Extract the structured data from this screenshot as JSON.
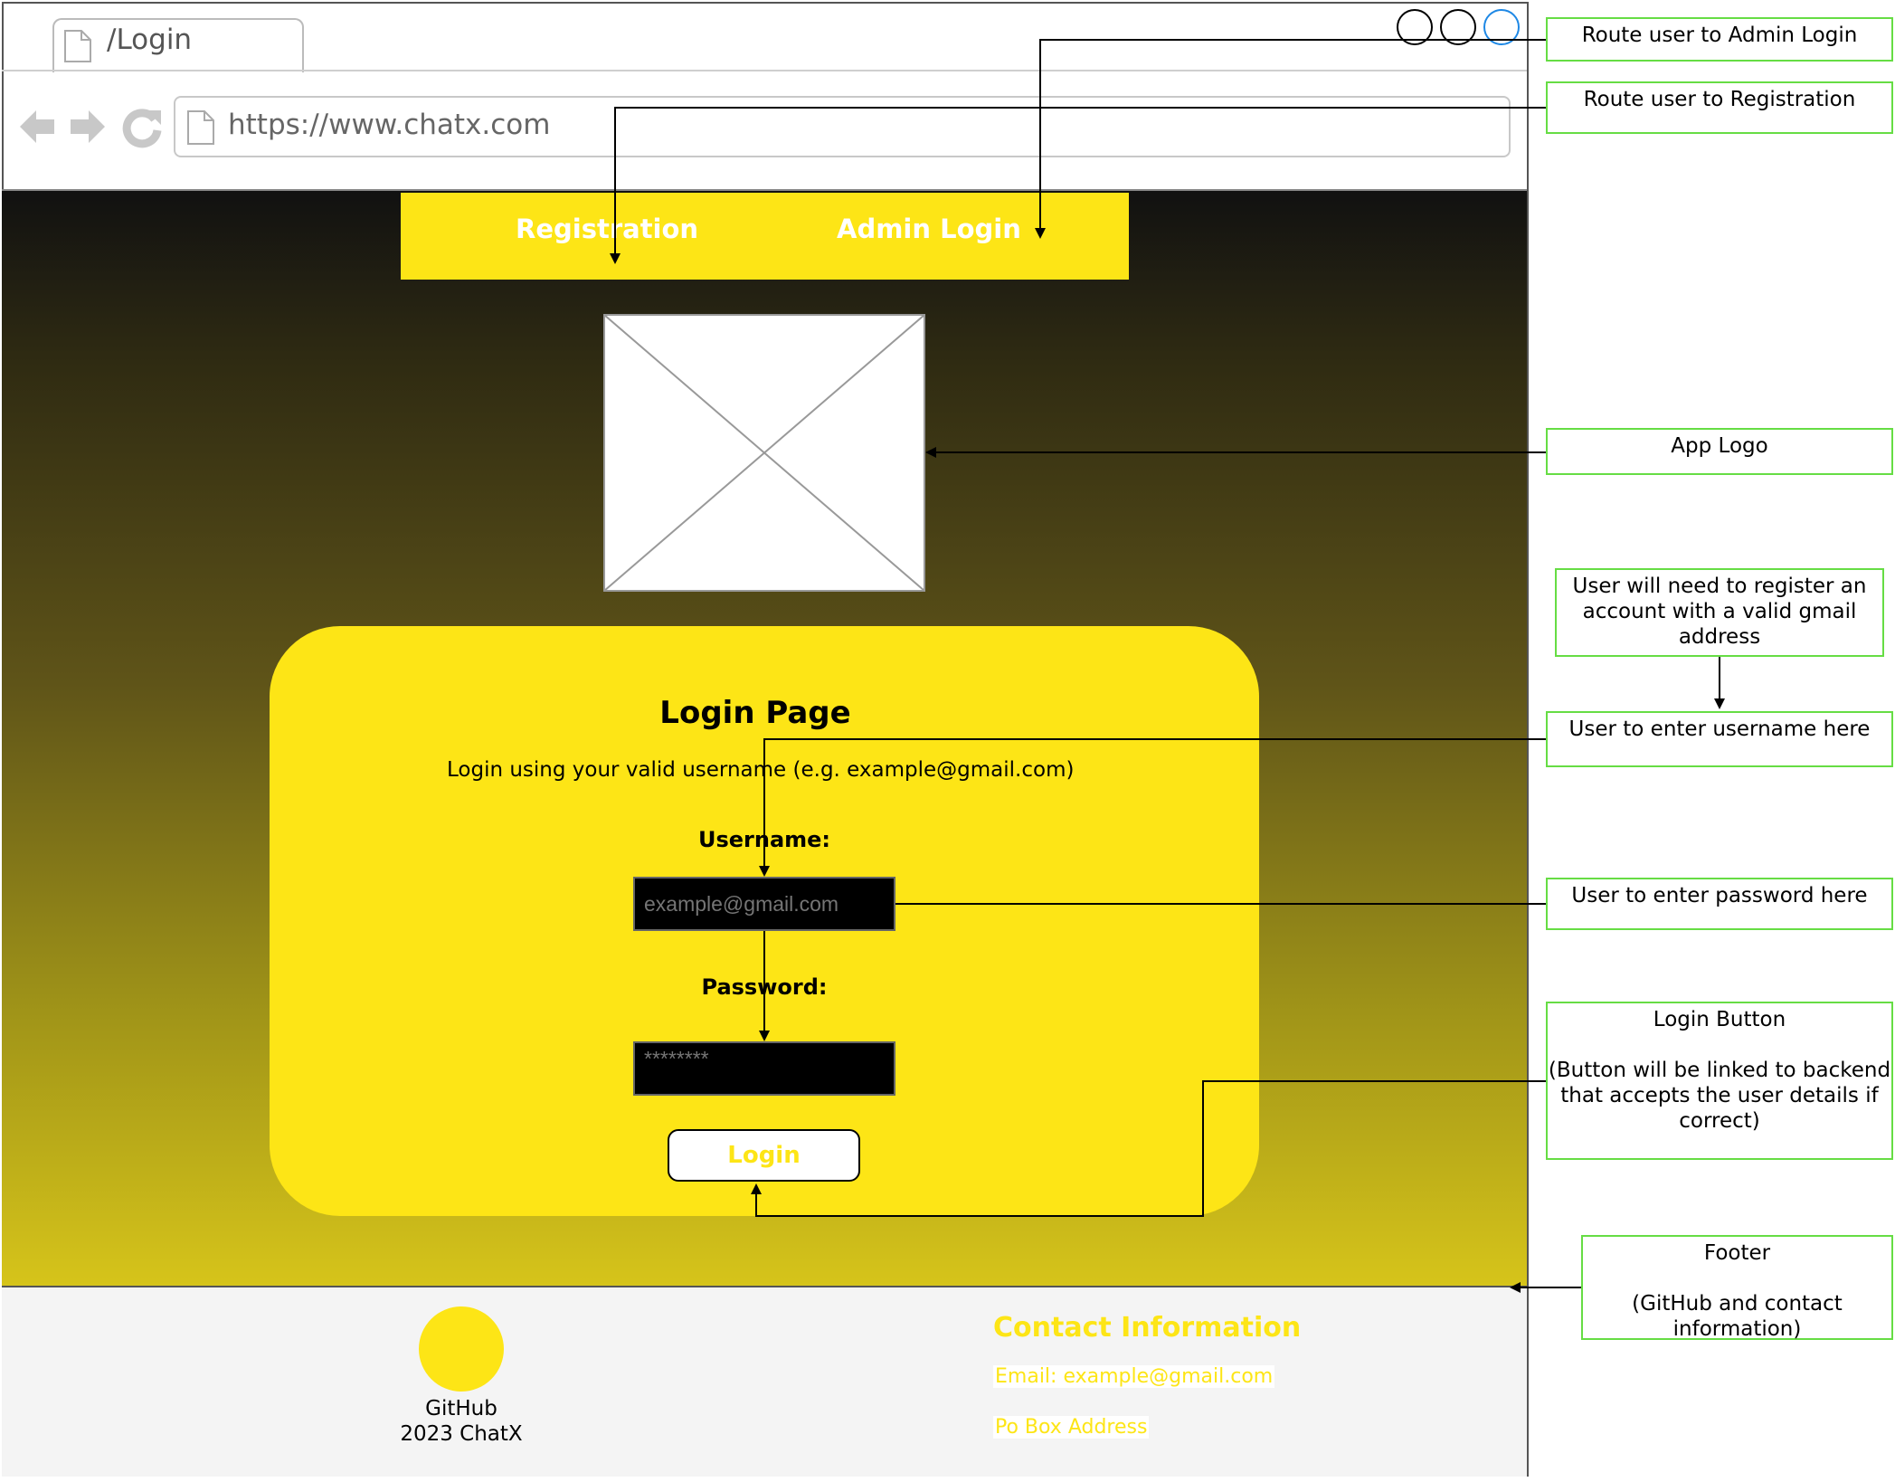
{
  "browser": {
    "tab_title": "/Login",
    "url": "https://www.chatx.com",
    "icons": [
      "back-arrow-icon",
      "forward-arrow-icon",
      "reload-icon",
      "page-icon"
    ]
  },
  "navbar": {
    "registration": "Registration",
    "admin_login": "Admin Login"
  },
  "card": {
    "title": "Login Page",
    "subtitle": "Login using your valid username (e.g. example@gmail.com)",
    "username_label": "Username:",
    "username_placeholder": "example@gmail.com",
    "password_label": "Password:",
    "password_placeholder": "********",
    "login_button": "Login"
  },
  "footer": {
    "github_line1": "GitHub",
    "github_line2": "2023 ChatX",
    "contact_title": "Contact Information",
    "contact_email": "Email: example@gmail.com",
    "contact_address": "Po Box Address"
  },
  "annotations": {
    "admin": "Route user to Admin Login",
    "registration": "Route user to Registration",
    "logo": "App Logo",
    "register_note": "User will need to register an account with a valid gmail address",
    "username": "User to enter username here",
    "password": "User to enter password here",
    "login_button": "Login Button\n\n(Button will be linked to backend that accepts the user details if correct)",
    "footer": "Footer\n\n(GitHub and contact information)"
  },
  "colors": {
    "accent_yellow": "#fde516",
    "annotation_border": "#66dd44",
    "footer_bg": "#f4f4f4"
  }
}
